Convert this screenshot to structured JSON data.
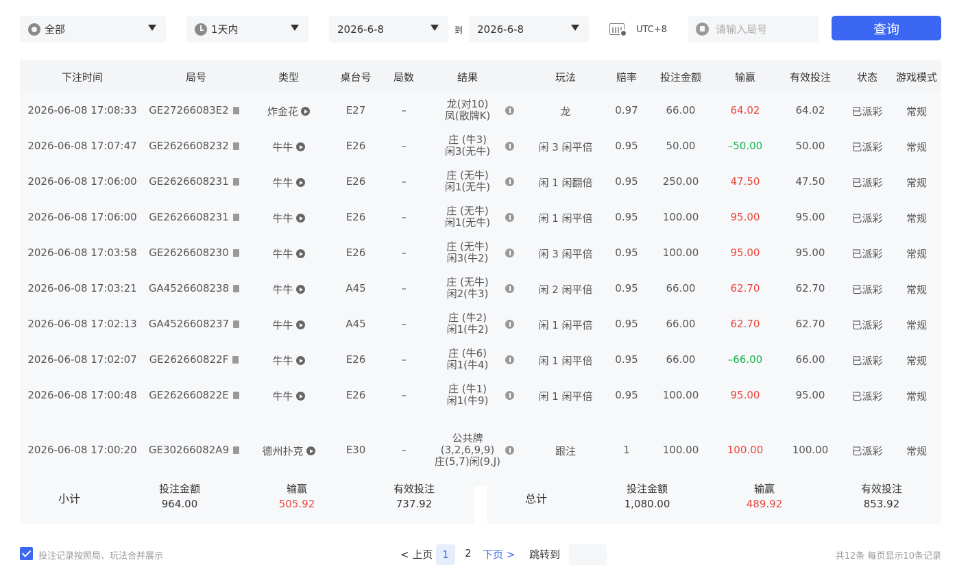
{
  "filters": {
    "category": "全部",
    "period": "1天内",
    "date_from": "2026-6-8",
    "to_label": "到",
    "date_to": "2026-6-8",
    "timezone": "UTC+8",
    "round_placeholder": "请输入局号",
    "query_label": "查询"
  },
  "columns": [
    "下注时间",
    "局号",
    "类型",
    "桌台号",
    "局数",
    "结果",
    "玩法",
    "赔率",
    "投注金额",
    "输赢",
    "有效投注",
    "状态",
    "游戏模式"
  ],
  "rows": [
    {
      "time": "2026-06-08 17:08:33",
      "round": "GE27266083E2",
      "type": "炸金花",
      "table": "E27",
      "count": "–",
      "result": [
        "龙(对10)",
        "凤(散牌K)"
      ],
      "play": "龙",
      "odds": "0.97",
      "bet": "66.00",
      "winloss": "64.02",
      "valid": "64.02",
      "status": "已派彩",
      "mode": "常规"
    },
    {
      "time": "2026-06-08 17:07:47",
      "round": "GE2626608232",
      "type": "牛牛",
      "table": "E26",
      "count": "–",
      "result": [
        "庄 (牛3)",
        "闲3(无牛)"
      ],
      "play": "闲 3 闲平倍",
      "odds": "0.95",
      "bet": "50.00",
      "winloss": "–50.00",
      "valid": "50.00",
      "status": "已派彩",
      "mode": "常规"
    },
    {
      "time": "2026-06-08 17:06:00",
      "round": "GE2626608231",
      "type": "牛牛",
      "table": "E26",
      "count": "–",
      "result": [
        "庄 (无牛)",
        "闲1(无牛)"
      ],
      "play": "闲 1 闲翻倍",
      "odds": "0.95",
      "bet": "250.00",
      "winloss": "47.50",
      "valid": "47.50",
      "status": "已派彩",
      "mode": "常规"
    },
    {
      "time": "2026-06-08 17:06:00",
      "round": "GE2626608231",
      "type": "牛牛",
      "table": "E26",
      "count": "–",
      "result": [
        "庄 (无牛)",
        "闲1(无牛)"
      ],
      "play": "闲 1 闲平倍",
      "odds": "0.95",
      "bet": "100.00",
      "winloss": "95.00",
      "valid": "95.00",
      "status": "已派彩",
      "mode": "常规"
    },
    {
      "time": "2026-06-08 17:03:58",
      "round": "GE2626608230",
      "type": "牛牛",
      "table": "E26",
      "count": "–",
      "result": [
        "庄 (无牛)",
        "闲3(牛2)"
      ],
      "play": "闲 3 闲平倍",
      "odds": "0.95",
      "bet": "100.00",
      "winloss": "95.00",
      "valid": "95.00",
      "status": "已派彩",
      "mode": "常规"
    },
    {
      "time": "2026-06-08 17:03:21",
      "round": "GA4526608238",
      "type": "牛牛",
      "table": "A45",
      "count": "–",
      "result": [
        "庄 (无牛)",
        "闲2(牛3)"
      ],
      "play": "闲 2 闲平倍",
      "odds": "0.95",
      "bet": "66.00",
      "winloss": "62.70",
      "valid": "62.70",
      "status": "已派彩",
      "mode": "常规"
    },
    {
      "time": "2026-06-08 17:02:13",
      "round": "GA4526608237",
      "type": "牛牛",
      "table": "A45",
      "count": "–",
      "result": [
        "庄 (牛2)",
        "闲1(牛2)"
      ],
      "play": "闲 1 闲平倍",
      "odds": "0.95",
      "bet": "66.00",
      "winloss": "62.70",
      "valid": "62.70",
      "status": "已派彩",
      "mode": "常规"
    },
    {
      "time": "2026-06-08 17:02:07",
      "round": "GE262660822F",
      "type": "牛牛",
      "table": "E26",
      "count": "–",
      "result": [
        "庄 (牛6)",
        "闲1(牛4)"
      ],
      "play": "闲 1 闲平倍",
      "odds": "0.95",
      "bet": "66.00",
      "winloss": "–66.00",
      "valid": "66.00",
      "status": "已派彩",
      "mode": "常规"
    },
    {
      "time": "2026-06-08 17:00:48",
      "round": "GE262660822E",
      "type": "牛牛",
      "table": "E26",
      "count": "–",
      "result": [
        "庄 (牛1)",
        "闲1(牛9)"
      ],
      "play": "闲 1 闲平倍",
      "odds": "0.95",
      "bet": "100.00",
      "winloss": "95.00",
      "valid": "95.00",
      "status": "已派彩",
      "mode": "常规"
    },
    {
      "time": "2026-06-08 17:00:20",
      "round": "GE30266082A9",
      "type": "德州扑克",
      "table": "E30",
      "count": "–",
      "result": [
        "公共牌",
        "(3,2,6,9,9)",
        "庄(5,7)闲(9,J)"
      ],
      "play": "跟注",
      "odds": "1",
      "bet": "100.00",
      "winloss": "100.00",
      "valid": "100.00",
      "status": "已派彩",
      "mode": "常规"
    }
  ],
  "subtotal": {
    "label": "小计",
    "bet_label": "投注金额",
    "bet": "964.00",
    "winloss_label": "输赢",
    "winloss": "505.92",
    "valid_label": "有效投注",
    "valid": "737.92"
  },
  "total": {
    "label": "总计",
    "bet_label": "投注金额",
    "bet": "1,080.00",
    "winloss_label": "输赢",
    "winloss": "489.92",
    "valid_label": "有效投注",
    "valid": "853.92"
  },
  "footer": {
    "merge_label": "投注记录按照局、玩法合并展示",
    "merge_checked": true,
    "prev": "< 上页",
    "current_page": "1",
    "page2": "2",
    "next": "下页 >",
    "jump": "跳转到",
    "summary": "共12条  每页显示10条记录"
  },
  "colors": {
    "accent": "#3b67f2",
    "win": "#e8453c",
    "lose": "#19b34b"
  }
}
